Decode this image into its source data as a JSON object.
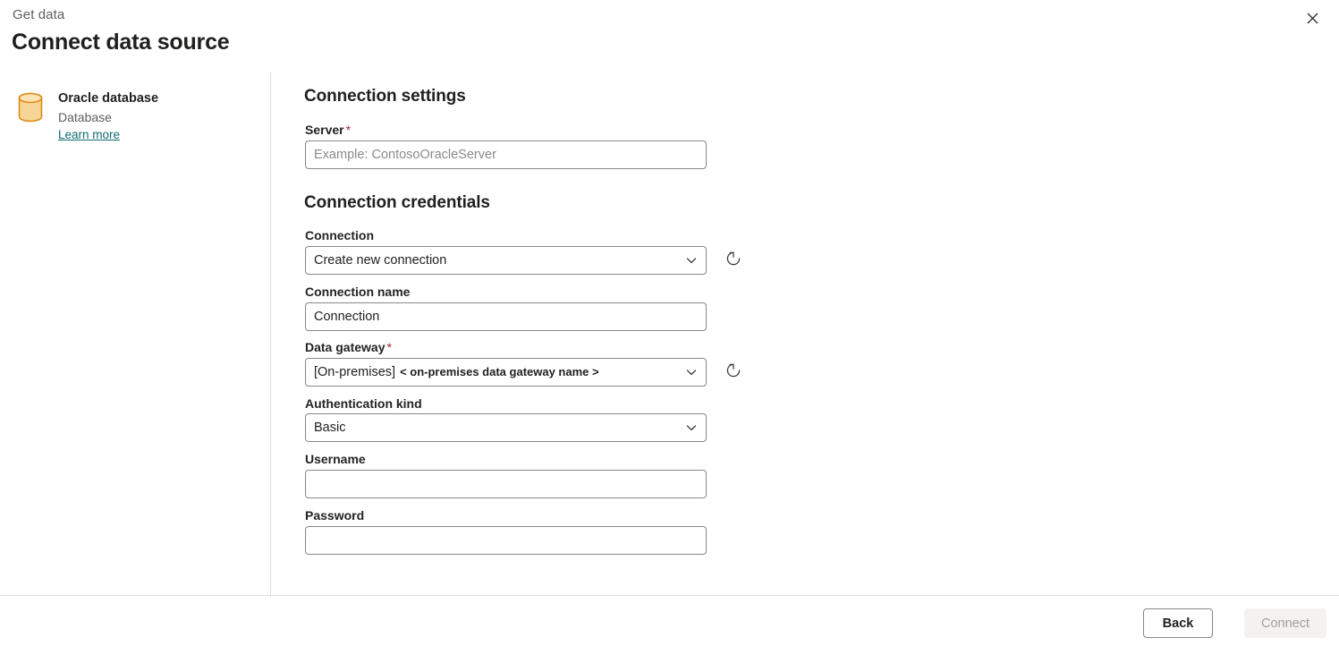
{
  "header": {
    "eyebrow": "Get data",
    "title": "Connect data source",
    "close_icon": "close-icon"
  },
  "source": {
    "icon": "database-cylinder-icon",
    "name": "Oracle database",
    "kind": "Database",
    "learn_more": "Learn more"
  },
  "sections": {
    "connection_settings": "Connection settings",
    "connection_credentials": "Connection credentials"
  },
  "fields": {
    "server": {
      "label": "Server",
      "required_marker": "*",
      "value": "",
      "placeholder": "Example: ContosoOracleServer"
    },
    "connection": {
      "label": "Connection",
      "value": "Create new connection",
      "chevron_icon": "chevron-down-icon",
      "refresh_icon": "refresh-icon"
    },
    "connection_name": {
      "label": "Connection name",
      "value": "Connection",
      "placeholder": ""
    },
    "data_gateway": {
      "label": "Data gateway",
      "required_marker": "*",
      "value_prefix": "[On-premises]",
      "value_name": "< on-premises data gateway name >",
      "chevron_icon": "chevron-down-icon",
      "refresh_icon": "refresh-icon"
    },
    "authentication_kind": {
      "label": "Authentication kind",
      "value": "Basic",
      "chevron_icon": "chevron-down-icon"
    },
    "username": {
      "label": "Username",
      "value": "",
      "placeholder": ""
    },
    "password": {
      "label": "Password",
      "value": "",
      "placeholder": ""
    }
  },
  "footer": {
    "back_label": "Back",
    "connect_label": "Connect"
  },
  "colors": {
    "accent_link": "#0f6c71",
    "required": "#a4262c",
    "icon_orange": "#d97b00",
    "icon_fill": "#f6d29a",
    "border": "#8a8886",
    "divider": "#e1dfdd"
  }
}
